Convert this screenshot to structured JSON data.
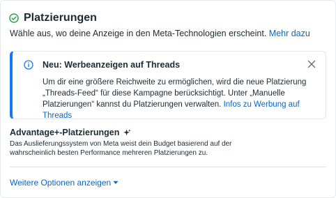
{
  "header": {
    "title": "Platzierungen",
    "subtitle": "Wähle aus, wo deine Anzeige in den Meta-Technologien erscheint.",
    "learn_more": "Mehr dazu"
  },
  "notice": {
    "title": "Neu: Werbeanzeigen auf Threads",
    "body": "Um dir eine größere Reichweite zu ermöglichen, wird die neue Platzierung „Threads-Feed“ für diese Kampagne berücksichtigt. Unter „Manuelle Platzierungen“ kannst du Platzierungen verwalten.",
    "link": "Infos zu Werbung auf Threads"
  },
  "advantage": {
    "title": "Advantage+-Platzierungen",
    "description": "Das Auslieferungssystem von Meta weist dein Budget basierend auf der wahrscheinlich besten Performance mehreren Platzierungen zu."
  },
  "more_options": "Weitere Optionen anzeigen",
  "colors": {
    "accent": "#1877f2",
    "link": "#0a66c2",
    "success": "#31a24c",
    "text": "#1c2b33"
  }
}
